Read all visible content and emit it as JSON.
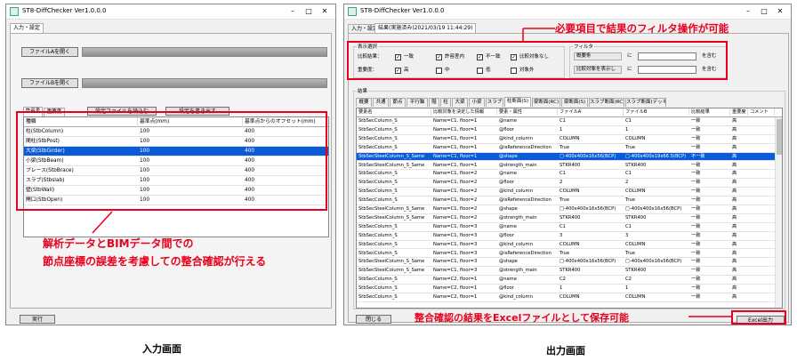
{
  "left_window": {
    "title": "ST8-DiffChecker Ver1.0.0.0",
    "tab": "入力・設定",
    "btn_file_a": "ファイルAを開く",
    "btn_file_b": "ファイルBを開く",
    "subtabs": [
      "許容差",
      "重要度"
    ],
    "btn_load_settings": "設定ファイルを読込む",
    "btn_save_settings": "設定を書き出す",
    "table": {
      "headers": [
        "種類",
        "基準点(mm)",
        "基準点からのオフセット(mm)"
      ],
      "rows": [
        [
          "柱(StbColumn)",
          "100",
          "400"
        ],
        [
          "間柱(StbPost)",
          "100",
          "400"
        ],
        [
          "大梁(StbGirder)",
          "100",
          "400"
        ],
        [
          "小梁(StbBeam)",
          "100",
          "400"
        ],
        [
          "ブレース(StbBrace)",
          "100",
          "400"
        ],
        [
          "スラブ(Stbslab)",
          "100",
          "400"
        ],
        [
          "壁(StbWall)",
          "100",
          "400"
        ],
        [
          "開口(StbOpen)",
          "100",
          "400"
        ]
      ],
      "selected_row": 2
    },
    "btn_run": "実行"
  },
  "left_annotation": [
    "解析データとBIMデータ間での",
    "節点座標の誤差を考慮しての整合確認が行える"
  ],
  "left_caption": "入力画面",
  "right_window": {
    "title": "ST8-DiffChecker Ver1.0.0.0",
    "tabs": [
      "入力・設定",
      "結果(実施済み)2021/03/19 11:44:29)"
    ],
    "display_group": {
      "label": "表示選択",
      "row1_label": "比較結果：",
      "row1_opts": [
        {
          "label": "一致",
          "checked": true
        },
        {
          "label": "許容差内",
          "checked": true
        },
        {
          "label": "不一致",
          "checked": true
        },
        {
          "label": "比較対象なし",
          "checked": true
        }
      ],
      "row2_label": "重要度：",
      "row2_opts": [
        {
          "label": "高",
          "checked": true
        },
        {
          "label": "中",
          "checked": false
        },
        {
          "label": "低",
          "checked": false
        },
        {
          "label": "対象外",
          "checked": false
        }
      ]
    },
    "filter_group": {
      "label": "フィルタ",
      "combo1": "概要条",
      "combo2": "比較対象を表示し",
      "label_ni": "に",
      "suffix1": "を含む",
      "suffix2": "を含む"
    },
    "result_group_label": "結果",
    "subtabs": [
      "概要",
      "共通",
      "節点",
      "平行軸",
      "階",
      "柱",
      "大梁",
      "小梁",
      "スラブ",
      "柱断面(S)",
      "梁断面(RC)",
      "梁断面(S)",
      "スラブ断面(RC)",
      "スラブ断面(デッキ)"
    ],
    "active_subtab": 9,
    "table": {
      "headers": [
        "要素名",
        "比較対象を決定した情報",
        "要素・属性",
        "ファイルA",
        "ファイルB",
        "比較結果",
        "重要度",
        "コメント"
      ],
      "rows": [
        [
          "StbSecColumn_S",
          "Name=C1, floor=1",
          "@name",
          "C1",
          "C1",
          "一致",
          "高",
          ""
        ],
        [
          "StbSecColumn_S",
          "Name=C1, floor=1",
          "@floor",
          "1",
          "1",
          "一致",
          "高",
          ""
        ],
        [
          "StbSecColumn_S",
          "Name=C1, floor=1",
          "@kind_column",
          "COLUMN",
          "COLUMN",
          "一致",
          "高",
          ""
        ],
        [
          "StbSecColumn_S",
          "Name=C1, floor=1",
          "@isReferenceDirection",
          "True",
          "True",
          "一致",
          "高",
          ""
        ],
        [
          "StbSecSteelColumn_S_Same",
          "Name=C1, floor=1",
          "@shape",
          "□-400x400x16x56(BCP)",
          "□-400x400x19x66.5(BCP)",
          "不一致",
          "高",
          ""
        ],
        [
          "StbSecSteelColumn_S_Same",
          "Name=C1, floor=1",
          "@strength_main",
          "STKR400",
          "STKR400",
          "一致",
          "高",
          ""
        ],
        [
          "StbSecColumn_S",
          "Name=C1, floor=2",
          "@name",
          "C1",
          "C1",
          "一致",
          "高",
          ""
        ],
        [
          "StbSecColumn_S",
          "Name=C1, floor=2",
          "@floor",
          "2",
          "2",
          "一致",
          "高",
          ""
        ],
        [
          "StbSecColumn_S",
          "Name=C1, floor=2",
          "@kind_column",
          "COLUMN",
          "COLUMN",
          "一致",
          "高",
          ""
        ],
        [
          "StbSecColumn_S",
          "Name=C1, floor=2",
          "@isReferenceDirection",
          "True",
          "True",
          "一致",
          "高",
          ""
        ],
        [
          "StbSecSteelColumn_S_Same",
          "Name=C1, floor=2",
          "@shape",
          "□-400x400x16x56(BCP)",
          "□-400x400x16x56(BCP)",
          "一致",
          "高",
          ""
        ],
        [
          "StbSecSteelColumn_S_Same",
          "Name=C1, floor=2",
          "@strength_main",
          "STKR400",
          "STKR400",
          "一致",
          "高",
          ""
        ],
        [
          "StbSecColumn_S",
          "Name=C1, floor=3",
          "@name",
          "C1",
          "C1",
          "一致",
          "高",
          ""
        ],
        [
          "StbSecColumn_S",
          "Name=C1, floor=3",
          "@floor",
          "3",
          "3",
          "一致",
          "高",
          ""
        ],
        [
          "StbSecColumn_S",
          "Name=C1, floor=3",
          "@kind_column",
          "COLUMN",
          "COLUMN",
          "一致",
          "高",
          ""
        ],
        [
          "StbSecColumn_S",
          "Name=C1, floor=3",
          "@isReferenceDirection",
          "True",
          "True",
          "一致",
          "高",
          ""
        ],
        [
          "StbSecSteelColumn_S_Same",
          "Name=C1, floor=3",
          "@shape",
          "□-400x400x16x56(BCP)",
          "□-400x400x16x56(BCP)",
          "一致",
          "高",
          ""
        ],
        [
          "StbSecSteelColumn_S_Same",
          "Name=C1, floor=3",
          "@strength_main",
          "STKR400",
          "STKR400",
          "一致",
          "高",
          ""
        ],
        [
          "StbSecColumn_S",
          "Name=C2, floor=1",
          "@name",
          "C2",
          "C2",
          "一致",
          "高",
          ""
        ],
        [
          "StbSecColumn_S",
          "Name=C2, floor=1",
          "@floor",
          "1",
          "1",
          "一致",
          "高",
          ""
        ],
        [
          "StbSecColumn_S",
          "Name=C2, floor=1",
          "@kind_column",
          "COLUMN",
          "COLUMN",
          "一致",
          "高",
          ""
        ]
      ],
      "selected_row": 4
    },
    "btn_close": "閉じる",
    "btn_excel": "Excel出力"
  },
  "right_annotation_top": "必要項目で結果のフィルタ操作が可能",
  "right_annotation_bottom": "整合確認の結果をExcelファイルとして保存可能",
  "right_caption": "出力画面",
  "colors": {
    "accent": "#e8001c",
    "selection": "#0a5bd7"
  }
}
